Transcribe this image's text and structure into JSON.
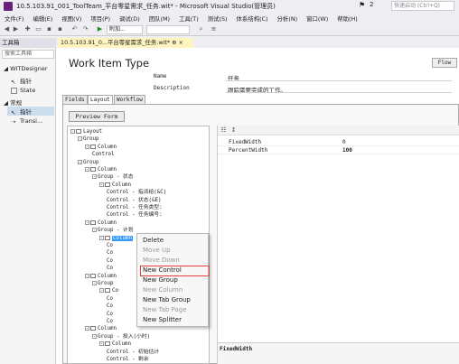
{
  "window": {
    "title": "10.5.103.91_001_ToolTeam_平台零星需求_任务.wit* - Microsoft Visual Studio(管理员)",
    "notification_count": "2",
    "quick_launch_placeholder": "快速启动 (Ctrl+Q)"
  },
  "menu": [
    "文件(F)",
    "编辑(E)",
    "视图(V)",
    "项目(P)",
    "调试(D)",
    "团队(M)",
    "工具(T)",
    "测试(S)",
    "体系结构(C)",
    "分析(N)",
    "窗口(W)",
    "帮助(H)"
  ],
  "toolbar": {
    "combo_label": "附加..."
  },
  "toolbox": {
    "title": "工具箱",
    "search_placeholder": "搜索工具箱",
    "groups": [
      {
        "name": "WITDesigner",
        "items": [
          "指针",
          "State"
        ]
      },
      {
        "name": "常规",
        "items": [
          "指针",
          "Transi..."
        ]
      }
    ]
  },
  "document_tab": {
    "label": "10.5.103.91_0...平台零星需求_任务.wit* ⊕ ×"
  },
  "editor": {
    "title": "Work Item Type",
    "flow_button": "Flow",
    "name_label": "Name",
    "name_value": "任务",
    "desc_label": "Description",
    "desc_value": "跟踪需要完成的工作。",
    "tabs": [
      "Fields",
      "Layout",
      "Workflow"
    ],
    "preview_button": "Preview Form"
  },
  "tree": [
    {
      "depth": 0,
      "pm": "-",
      "icon": true,
      "label": "Layout"
    },
    {
      "depth": 1,
      "pm": "-",
      "icon": false,
      "label": "Group"
    },
    {
      "depth": 2,
      "pm": "-",
      "icon": true,
      "label": "Column"
    },
    {
      "depth": 3,
      "pm": "",
      "icon": false,
      "label": "Control"
    },
    {
      "depth": 1,
      "pm": "-",
      "icon": false,
      "label": "Group"
    },
    {
      "depth": 2,
      "pm": "-",
      "icon": true,
      "label": "Column"
    },
    {
      "depth": 3,
      "pm": "-",
      "icon": false,
      "label": "Group - 状态"
    },
    {
      "depth": 4,
      "pm": "-",
      "icon": true,
      "label": "Column"
    },
    {
      "depth": 5,
      "pm": "",
      "icon": false,
      "label": "Control - 指派给(&C)"
    },
    {
      "depth": 5,
      "pm": "",
      "icon": false,
      "label": "Control - 状态(&E)"
    },
    {
      "depth": 5,
      "pm": "",
      "icon": false,
      "label": "Control - 任务类型:"
    },
    {
      "depth": 5,
      "pm": "",
      "icon": false,
      "label": "Control - 任务编号:"
    },
    {
      "depth": 2,
      "pm": "-",
      "icon": true,
      "label": "Column"
    },
    {
      "depth": 3,
      "pm": "-",
      "icon": false,
      "label": "Group - 计划"
    },
    {
      "depth": 4,
      "pm": "-",
      "icon": true,
      "label": "Column",
      "selected": true
    },
    {
      "depth": 5,
      "pm": "",
      "icon": false,
      "label": "Co"
    },
    {
      "depth": 5,
      "pm": "",
      "icon": false,
      "label": "Co"
    },
    {
      "depth": 5,
      "pm": "",
      "icon": false,
      "label": "Co"
    },
    {
      "depth": 5,
      "pm": "",
      "icon": false,
      "label": "Co"
    },
    {
      "depth": 2,
      "pm": "-",
      "icon": true,
      "label": "Column"
    },
    {
      "depth": 3,
      "pm": "-",
      "icon": false,
      "label": "Group"
    },
    {
      "depth": 4,
      "pm": "-",
      "icon": true,
      "label": "Co"
    },
    {
      "depth": 5,
      "pm": "",
      "icon": false,
      "label": "Co"
    },
    {
      "depth": 5,
      "pm": "",
      "icon": false,
      "label": "Co"
    },
    {
      "depth": 5,
      "pm": "",
      "icon": false,
      "label": "Co"
    },
    {
      "depth": 5,
      "pm": "",
      "icon": false,
      "label": "Co"
    },
    {
      "depth": 2,
      "pm": "-",
      "icon": true,
      "label": "Column"
    },
    {
      "depth": 3,
      "pm": "-",
      "icon": false,
      "label": "Group - 投入(小时)"
    },
    {
      "depth": 4,
      "pm": "-",
      "icon": true,
      "label": "Column"
    },
    {
      "depth": 5,
      "pm": "",
      "icon": false,
      "label": "Control - 初始估计"
    },
    {
      "depth": 5,
      "pm": "",
      "icon": false,
      "label": "Control - 剩余"
    }
  ],
  "properties": {
    "rows": [
      {
        "name": "FixedWidth",
        "value": "0"
      },
      {
        "name": "PercentWidth",
        "value": "100"
      }
    ],
    "description_title": "FixedWidth"
  },
  "context_menu": [
    {
      "label": "Delete",
      "enabled": true
    },
    {
      "label": "Move Up",
      "enabled": false
    },
    {
      "label": "Move Down",
      "enabled": false
    },
    {
      "label": "New Control",
      "enabled": true,
      "highlighted": true
    },
    {
      "label": "New Group",
      "enabled": true
    },
    {
      "label": "New Column",
      "enabled": false
    },
    {
      "label": "New Tab Group",
      "enabled": true
    },
    {
      "label": "New Tab Page",
      "enabled": false
    },
    {
      "label": "New Splitter",
      "enabled": true
    }
  ],
  "colors": {
    "accent": "#68217a",
    "selection": "#3399ff",
    "highlight_box": "#e04040"
  }
}
